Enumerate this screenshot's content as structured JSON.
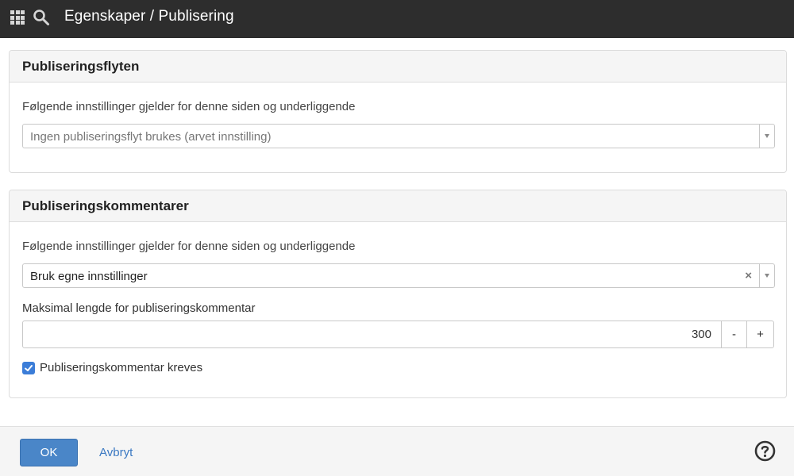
{
  "header": {
    "title": "Egenskaper / Publisering"
  },
  "panels": {
    "flow": {
      "title": "Publiseringsflyten",
      "description": "Følgende innstillinger gjelder for denne siden og underliggende",
      "select_value": "Ingen publiseringsflyt brukes (arvet innstilling)"
    },
    "comments": {
      "title": "Publiseringskommentarer",
      "description": "Følgende innstillinger gjelder for denne siden og underliggende",
      "select_value": "Bruk egne innstillinger",
      "clear_symbol": "×",
      "max_length_label": "Maksimal lengde for publiseringskommentar",
      "max_length_value": "300",
      "decrement_label": "-",
      "increment_label": "+",
      "required_label": "Publiseringskommentar kreves",
      "required_checked": true
    }
  },
  "footer": {
    "ok_label": "OK",
    "cancel_label": "Avbryt"
  },
  "icons": {
    "apps": "grid-icon",
    "search": "search-icon",
    "help": "help-icon"
  },
  "colors": {
    "topbar": "#2d2d2d",
    "primary": "#4a86c8",
    "link": "#3a78c2",
    "checkbox": "#3b7dd8"
  }
}
